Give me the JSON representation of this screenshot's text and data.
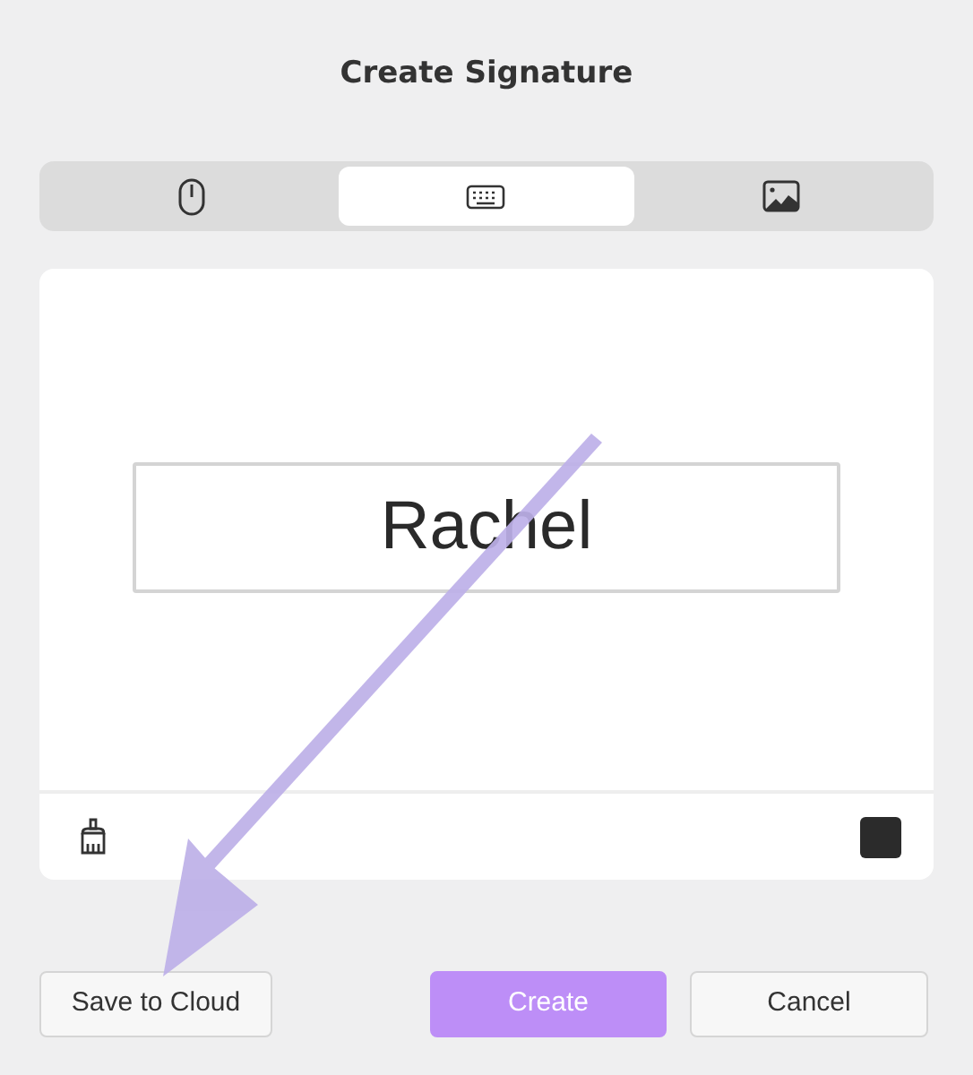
{
  "dialog": {
    "title": "Create Signature"
  },
  "tabs": [
    {
      "kind": "mouse",
      "selected": false
    },
    {
      "kind": "keyboard",
      "selected": true
    },
    {
      "kind": "image",
      "selected": false
    }
  ],
  "signature": {
    "value": "Rachel",
    "color": "#2b2b2b"
  },
  "buttons": [
    {
      "label": "Save to Cloud",
      "kind": "secondary"
    },
    {
      "label": "Create",
      "kind": "primary"
    },
    {
      "label": "Cancel",
      "kind": "secondary"
    }
  ],
  "annotation": {
    "kind": "arrow"
  }
}
